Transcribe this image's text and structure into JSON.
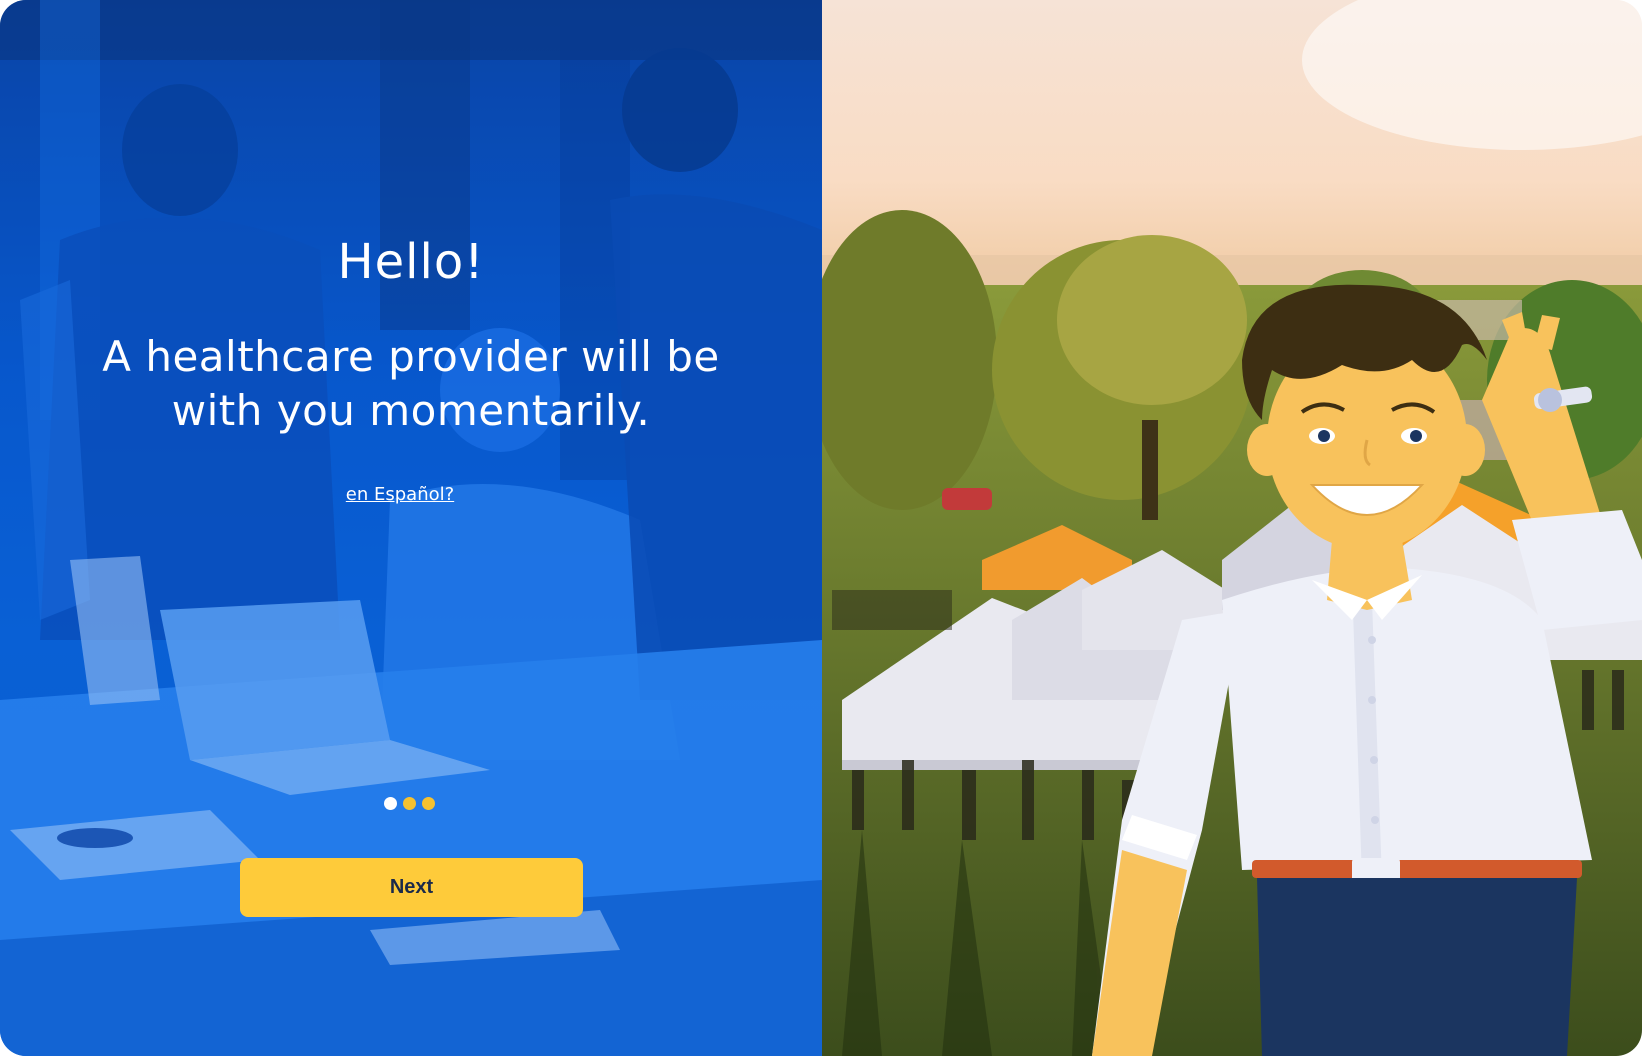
{
  "welcome": {
    "greeting": "Hello!",
    "message": "A healthcare provider will be with you momentarily.",
    "language_link": "en Español?",
    "pagination": {
      "total": 3,
      "active": 1
    },
    "next_label": "Next"
  },
  "colors": {
    "overlay_blue": "#0758cc",
    "accent_yellow": "#fecb3a",
    "button_text": "#1b2a4a"
  },
  "illustration": {
    "scene": "outdoor event tents at sunset",
    "character": "waving cartoon man"
  }
}
